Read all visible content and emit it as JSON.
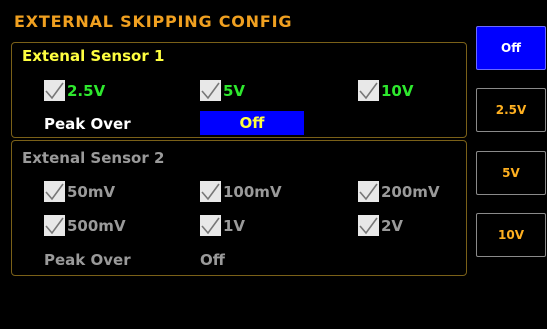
{
  "title": "EXTERNAL SKIPPING CONFIG",
  "sensor1": {
    "title": "Extenal Sensor 1",
    "options": [
      {
        "label": "2.5V",
        "checked": true
      },
      {
        "label": "5V",
        "checked": true
      },
      {
        "label": "10V",
        "checked": true
      }
    ],
    "peak_label": "Peak Over",
    "peak_value": "Off"
  },
  "sensor2": {
    "title": "Extenal Sensor 2",
    "options": [
      {
        "label": "50mV",
        "checked": true
      },
      {
        "label": "100mV",
        "checked": true
      },
      {
        "label": "200mV",
        "checked": true
      },
      {
        "label": "500mV",
        "checked": true
      },
      {
        "label": "1V",
        "checked": true
      },
      {
        "label": "2V",
        "checked": true
      }
    ],
    "peak_label": "Peak Over",
    "peak_value": "Off"
  },
  "side_buttons": [
    {
      "label": "Off",
      "active": true
    },
    {
      "label": "2.5V",
      "active": false
    },
    {
      "label": "5V",
      "active": false
    },
    {
      "label": "10V",
      "active": false
    }
  ],
  "colors": {
    "title": "#f0a020",
    "sensor1_title": "#ffff40",
    "enabled_option": "#2ee82e",
    "disabled_text": "#9a9a9a",
    "active_button_bg": "#0000ff",
    "idle_button_text": "#ffb020"
  },
  "icons": [
    "checkmark-icon"
  ]
}
